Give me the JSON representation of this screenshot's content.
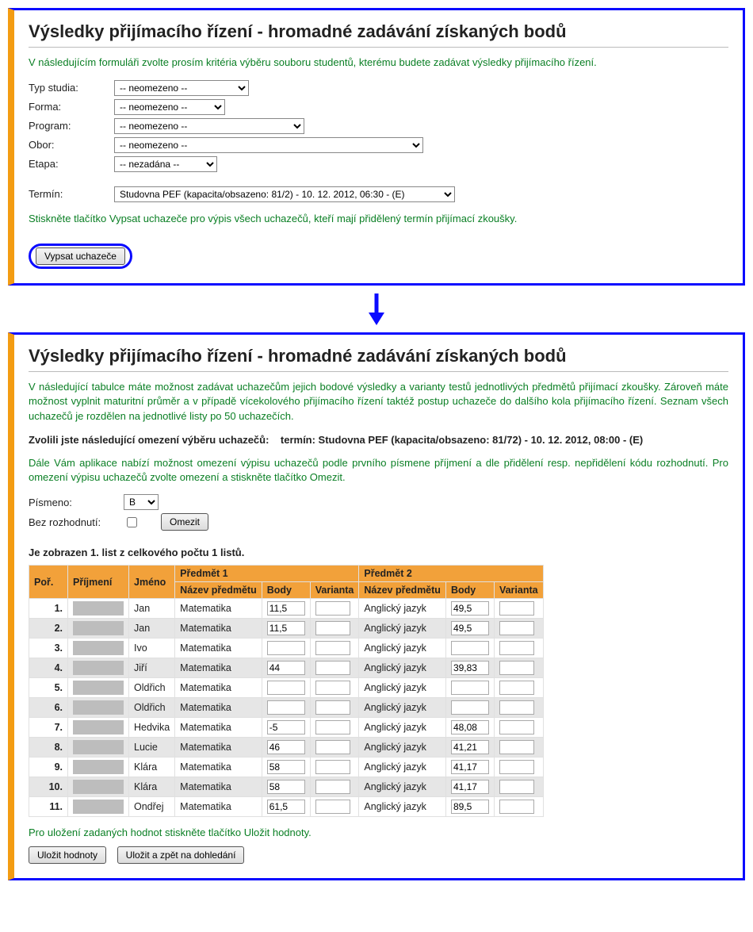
{
  "panel1": {
    "title": "Výsledky přijímacího řízení - hromadné zadávání získaných bodů",
    "intro": "V následujícím formuláři zvolte prosím kritéria výběru souboru studentů, kterému budete zadávat výsledky přijímacího řízení.",
    "labels": {
      "typ": "Typ studia:",
      "forma": "Forma:",
      "program": "Program:",
      "obor": "Obor:",
      "etapa": "Etapa:",
      "termin": "Termín:"
    },
    "opts": {
      "neomezeno": "-- neomezeno --",
      "nezadana": "-- nezadána --",
      "termin": "Studovna PEF (kapacita/obsazeno: 81/2) - 10. 12. 2012, 06:30 - (E)"
    },
    "hint": "Stiskněte tlačítko Vypsat uchazeče pro výpis všech uchazečů, kteří mají přidělený termín přijímací zkoušky.",
    "btn": "Vypsat uchazeče"
  },
  "panel2": {
    "title": "Výsledky přijímacího řízení - hromadné zadávání získaných bodů",
    "intro": "V následující tabulce máte možnost zadávat uchazečům jejich bodové výsledky a varianty testů jednotlivých předmětů přijímací zkoušky. Zároveň máte možnost vyplnit maturitní průměr a v případě vícekolového přijímacího řízení taktéž postup uchazeče do dalšího kola přijímacího řízení. Seznam všech uchazečů je rozdělen na jednotlivé listy po 50 uchazečích.",
    "selection_label": "Zvolili jste následující omezení výběru uchazečů:",
    "selection_value": "termín: Studovna PEF (kapacita/obsazeno: 81/72) - 10. 12. 2012, 08:00 - (E)",
    "hint2": "Dále Vám aplikace nabízí možnost omezení výpisu uchazečů podle prvního písmene příjmení a dle přidělení resp. nepřidělení kódu rozhodnutí. Pro omezení výpisu uchazečů zvolte omezení a stiskněte tlačítko Omezit.",
    "filters": {
      "pismeno_label": "Písmeno:",
      "pismeno_value": "B",
      "bez_label": "Bez rozhodnutí:",
      "btn": "Omezit"
    },
    "list_caption": "Je zobrazen 1. list z celkového počtu 1 listů.",
    "headers": {
      "por": "Poř.",
      "prijmeni": "Příjmení",
      "jmeno": "Jméno",
      "predmet1": "Předmět 1",
      "predmet2": "Předmět 2",
      "nazev": "Název předmětu",
      "body": "Body",
      "varianta": "Varianta"
    },
    "rows": [
      {
        "n": "1.",
        "jm": "Jan",
        "p1": "Matematika",
        "b1": "11,5",
        "v1": "",
        "p2": "Anglický jazyk",
        "b2": "49,5",
        "v2": ""
      },
      {
        "n": "2.",
        "jm": "Jan",
        "p1": "Matematika",
        "b1": "11,5",
        "v1": "",
        "p2": "Anglický jazyk",
        "b2": "49,5",
        "v2": ""
      },
      {
        "n": "3.",
        "jm": "Ivo",
        "p1": "Matematika",
        "b1": "",
        "v1": "",
        "p2": "Anglický jazyk",
        "b2": "",
        "v2": ""
      },
      {
        "n": "4.",
        "jm": "Jiří",
        "p1": "Matematika",
        "b1": "44",
        "v1": "",
        "p2": "Anglický jazyk",
        "b2": "39,83",
        "v2": ""
      },
      {
        "n": "5.",
        "jm": "Oldřich",
        "p1": "Matematika",
        "b1": "",
        "v1": "",
        "p2": "Anglický jazyk",
        "b2": "",
        "v2": ""
      },
      {
        "n": "6.",
        "jm": "Oldřich",
        "p1": "Matematika",
        "b1": "",
        "v1": "",
        "p2": "Anglický jazyk",
        "b2": "",
        "v2": ""
      },
      {
        "n": "7.",
        "jm": "Hedvika",
        "p1": "Matematika",
        "b1": "-5",
        "v1": "",
        "p2": "Anglický jazyk",
        "b2": "48,08",
        "v2": ""
      },
      {
        "n": "8.",
        "jm": "Lucie",
        "p1": "Matematika",
        "b1": "46",
        "v1": "",
        "p2": "Anglický jazyk",
        "b2": "41,21",
        "v2": ""
      },
      {
        "n": "9.",
        "jm": "Klára",
        "p1": "Matematika",
        "b1": "58",
        "v1": "",
        "p2": "Anglický jazyk",
        "b2": "41,17",
        "v2": ""
      },
      {
        "n": "10.",
        "jm": "Klára",
        "p1": "Matematika",
        "b1": "58",
        "v1": "",
        "p2": "Anglický jazyk",
        "b2": "41,17",
        "v2": ""
      },
      {
        "n": "11.",
        "jm": "Ondřej",
        "p1": "Matematika",
        "b1": "61,5",
        "v1": "",
        "p2": "Anglický jazyk",
        "b2": "89,5",
        "v2": ""
      }
    ],
    "save_note": "Pro uložení zadaných hodnot stiskněte tlačítko Uložit hodnoty.",
    "btn_save": "Uložit hodnoty",
    "btn_save_back": "Uložit a zpět na dohledání"
  }
}
